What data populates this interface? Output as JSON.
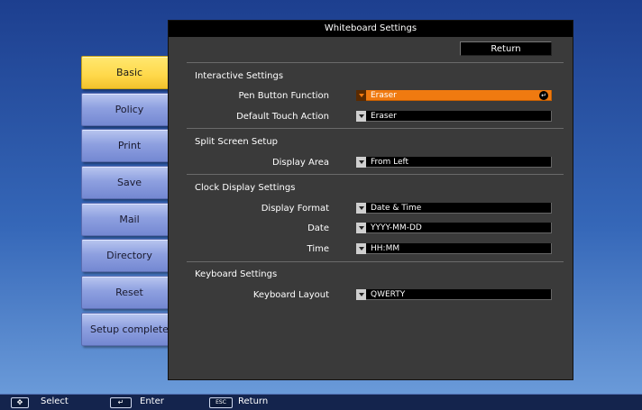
{
  "window": {
    "title": "Whiteboard Settings"
  },
  "tabs": [
    {
      "label": "Basic",
      "active": true
    },
    {
      "label": "Policy"
    },
    {
      "label": "Print"
    },
    {
      "label": "Save"
    },
    {
      "label": "Mail"
    },
    {
      "label": "Directory"
    },
    {
      "label": "Reset"
    },
    {
      "label": "Setup complete"
    }
  ],
  "return_button": "Return",
  "sections": {
    "interactive": {
      "title": "Interactive Settings",
      "pen_button_function": {
        "label": "Pen Button Function",
        "value": "Eraser"
      },
      "default_touch_action": {
        "label": "Default Touch Action",
        "value": "Eraser"
      }
    },
    "split_screen": {
      "title": "Split Screen Setup",
      "display_area": {
        "label": "Display Area",
        "value": "From Left"
      }
    },
    "clock": {
      "title": "Clock Display Settings",
      "display_format": {
        "label": "Display Format",
        "value": "Date & Time"
      },
      "date": {
        "label": "Date",
        "value": "YYYY-MM-DD"
      },
      "time": {
        "label": "Time",
        "value": "HH:MM"
      }
    },
    "keyboard": {
      "title": "Keyboard Settings",
      "keyboard_layout": {
        "label": "Keyboard Layout",
        "value": "QWERTY"
      }
    }
  },
  "bottom_bar": {
    "select_key": "✥",
    "select_label": "Select",
    "enter_key": "↵",
    "enter_label": "Enter",
    "esc_key": "ESC",
    "return_label": "Return"
  },
  "colors": {
    "active_tab": "#ffd84a",
    "inactive_tab": "#8ea0e0",
    "highlight_field": "#f07a10",
    "panel_background": "#3a3a3a"
  }
}
